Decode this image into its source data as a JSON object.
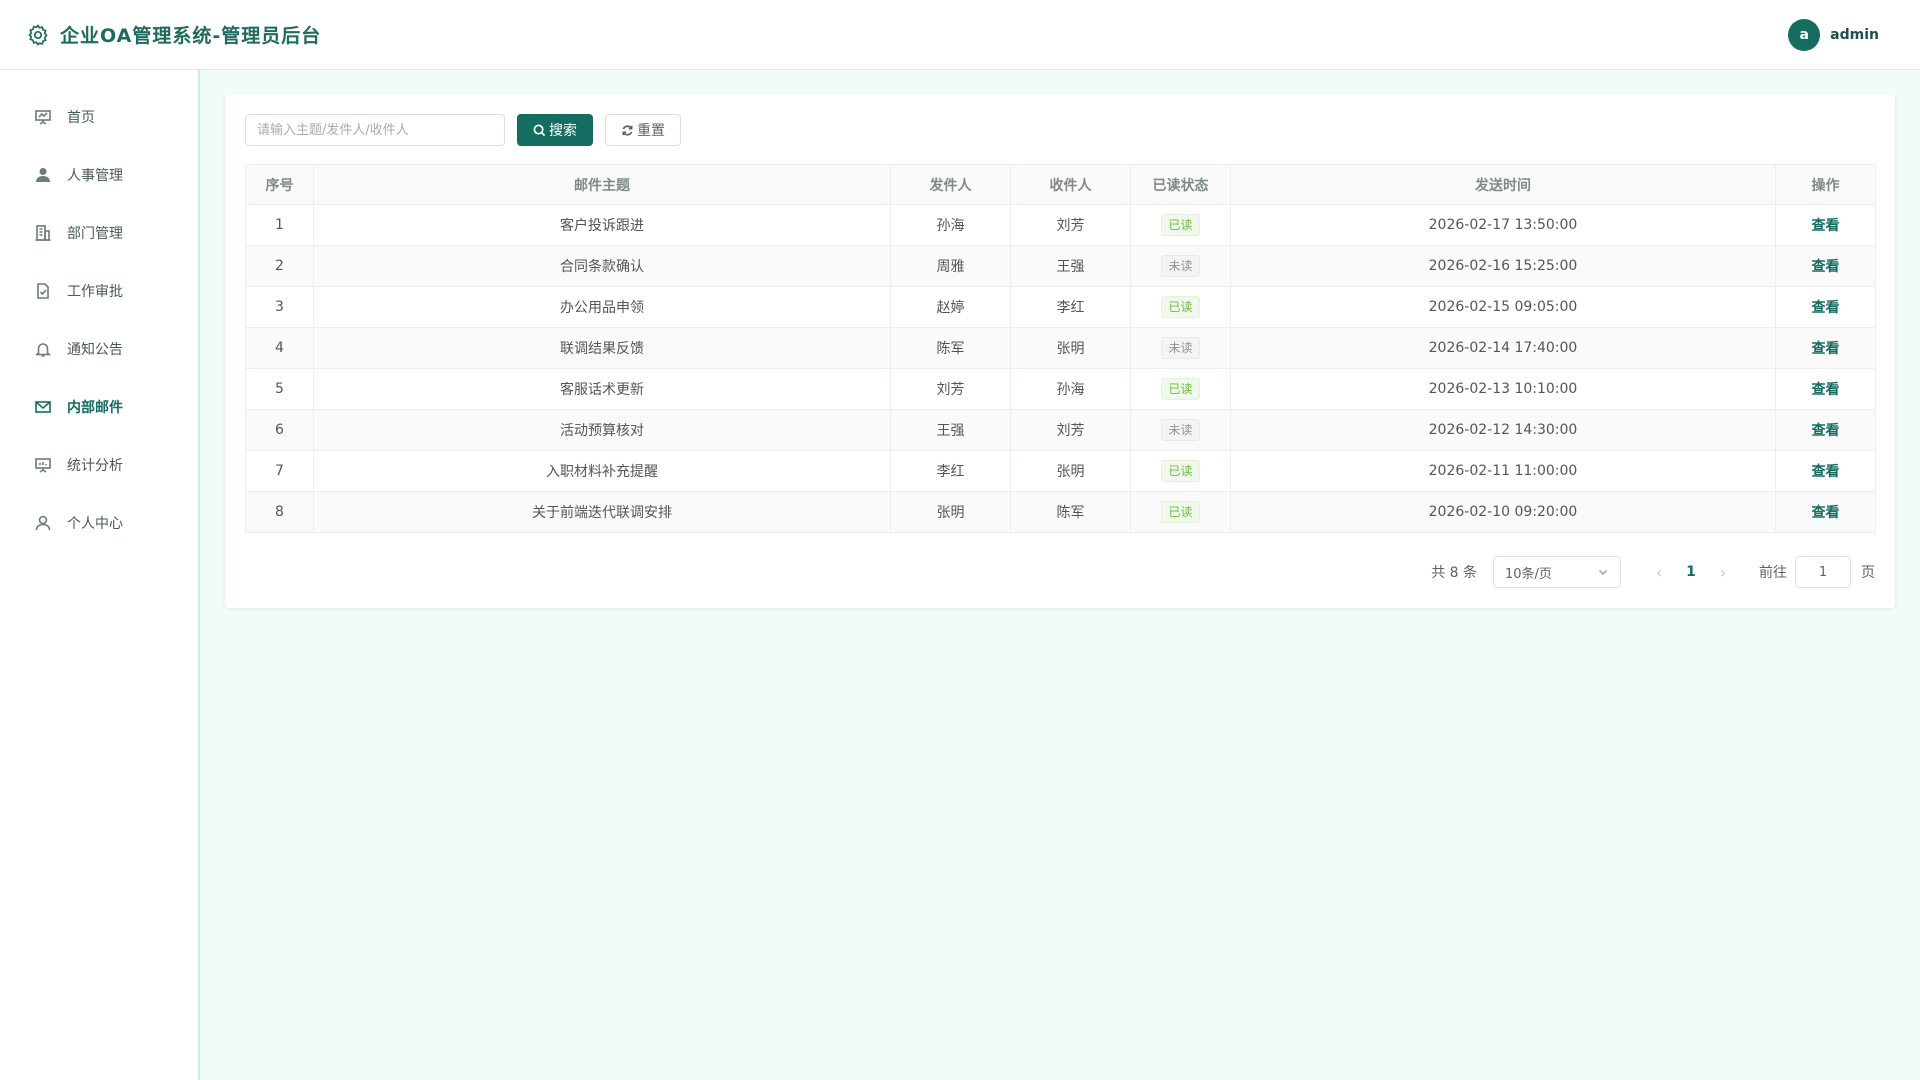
{
  "header": {
    "title": "企业OA管理系统-管理员后台",
    "avatar_letter": "a",
    "username": "admin"
  },
  "sidebar": {
    "items": [
      {
        "label": "首页",
        "icon": "presentation-icon"
      },
      {
        "label": "人事管理",
        "icon": "user-filled-icon"
      },
      {
        "label": "部门管理",
        "icon": "building-icon"
      },
      {
        "label": "工作审批",
        "icon": "document-checked-icon"
      },
      {
        "label": "通知公告",
        "icon": "bell-icon"
      },
      {
        "label": "内部邮件",
        "icon": "message-icon",
        "active": true
      },
      {
        "label": "统计分析",
        "icon": "data-board-icon"
      },
      {
        "label": "个人中心",
        "icon": "user-icon"
      }
    ]
  },
  "toolbar": {
    "search_placeholder": "请输入主题/发件人/收件人",
    "search_label": "搜索",
    "reset_label": "重置"
  },
  "table": {
    "headers": [
      "序号",
      "邮件主题",
      "发件人",
      "收件人",
      "已读状态",
      "发送时间",
      "操作"
    ],
    "rows": [
      {
        "no": "1",
        "subject": "客户投诉跟进",
        "sender": "孙海",
        "receiver": "刘芳",
        "status": "已读",
        "read": true,
        "time": "2026-02-17 13:50:00",
        "action": "查看"
      },
      {
        "no": "2",
        "subject": "合同条款确认",
        "sender": "周雅",
        "receiver": "王强",
        "status": "未读",
        "read": false,
        "time": "2026-02-16 15:25:00",
        "action": "查看"
      },
      {
        "no": "3",
        "subject": "办公用品申领",
        "sender": "赵婷",
        "receiver": "李红",
        "status": "已读",
        "read": true,
        "time": "2026-02-15 09:05:00",
        "action": "查看"
      },
      {
        "no": "4",
        "subject": "联调结果反馈",
        "sender": "陈军",
        "receiver": "张明",
        "status": "未读",
        "read": false,
        "time": "2026-02-14 17:40:00",
        "action": "查看"
      },
      {
        "no": "5",
        "subject": "客服话术更新",
        "sender": "刘芳",
        "receiver": "孙海",
        "status": "已读",
        "read": true,
        "time": "2026-02-13 10:10:00",
        "action": "查看"
      },
      {
        "no": "6",
        "subject": "活动预算核对",
        "sender": "王强",
        "receiver": "刘芳",
        "status": "未读",
        "read": false,
        "time": "2026-02-12 14:30:00",
        "action": "查看"
      },
      {
        "no": "7",
        "subject": "入职材料补充提醒",
        "sender": "李红",
        "receiver": "张明",
        "status": "已读",
        "read": true,
        "time": "2026-02-11 11:00:00",
        "action": "查看"
      },
      {
        "no": "8",
        "subject": "关于前端迭代联调安排",
        "sender": "张明",
        "receiver": "陈军",
        "status": "已读",
        "read": true,
        "time": "2026-02-10 09:20:00",
        "action": "查看"
      }
    ]
  },
  "pagination": {
    "total_text": "共 8 条",
    "page_size": "10条/页",
    "current_page": "1",
    "goto_label": "前往",
    "goto_value": "1",
    "page_unit": "页"
  },
  "colors": {
    "primary": "#156d61",
    "background": "#f1fbf9",
    "read_tag": "#67c23a",
    "unread_tag": "#909399"
  }
}
